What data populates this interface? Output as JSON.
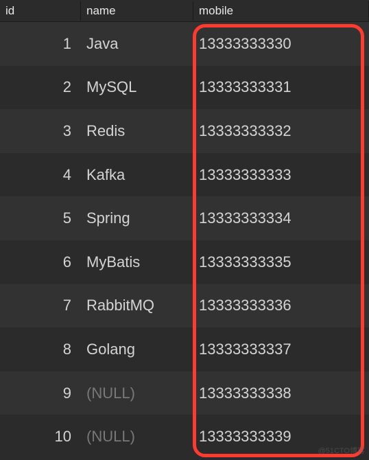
{
  "headers": {
    "id": "id",
    "name": "name",
    "mobile": "mobile"
  },
  "rows": [
    {
      "id": "1",
      "name": "Java",
      "mobile": "13333333330",
      "null_name": false
    },
    {
      "id": "2",
      "name": "MySQL",
      "mobile": "13333333331",
      "null_name": false
    },
    {
      "id": "3",
      "name": "Redis",
      "mobile": "13333333332",
      "null_name": false
    },
    {
      "id": "4",
      "name": "Kafka",
      "mobile": "13333333333",
      "null_name": false
    },
    {
      "id": "5",
      "name": "Spring",
      "mobile": "13333333334",
      "null_name": false
    },
    {
      "id": "6",
      "name": "MyBatis",
      "mobile": "13333333335",
      "null_name": false
    },
    {
      "id": "7",
      "name": "RabbitMQ",
      "mobile": "13333333336",
      "null_name": false
    },
    {
      "id": "8",
      "name": "Golang",
      "mobile": "13333333337",
      "null_name": false
    },
    {
      "id": "9",
      "name": "(NULL)",
      "mobile": "13333333338",
      "null_name": true
    },
    {
      "id": "10",
      "name": "(NULL)",
      "mobile": "13333333339",
      "null_name": true
    }
  ],
  "watermark": "@51CTO博客"
}
